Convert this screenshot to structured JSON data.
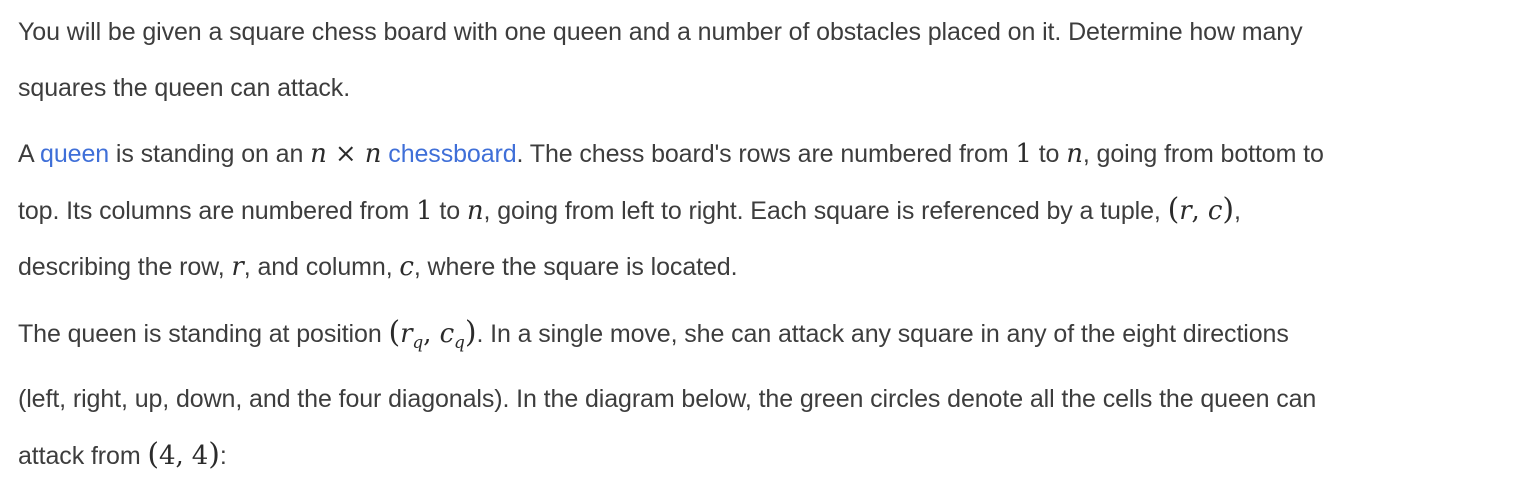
{
  "intro": {
    "line1": "You will be given a square chess board with one queen and a number of obstacles placed on it. Determine how many",
    "line2": "squares the queen can attack."
  },
  "para1": {
    "t1": "A ",
    "link_queen": "queen",
    "t2": " is standing on an ",
    "math_n1": "n",
    "math_times": " × ",
    "math_n2": "n",
    "t3": " ",
    "link_chessboard": "chessboard",
    "t4": ". The chess board's rows are numbered from ",
    "math_one1": "1",
    "t5": " to ",
    "math_n3": "n",
    "t6": ", going from bottom to",
    "t7": "top. Its columns are numbered from ",
    "math_one2": "1",
    "t8": " to ",
    "math_n4": "n",
    "t9": ", going from left to right. Each square is referenced by a tuple, ",
    "tuple_open": "(",
    "tuple_r": "r",
    "tuple_comma": ", ",
    "tuple_c": "c",
    "tuple_close": ")",
    "t10": ",",
    "t11": "describing the row, ",
    "math_r": "r",
    "t12": ", and column, ",
    "math_c": "c",
    "t13": ", where the square is located."
  },
  "para2": {
    "t1": "The queen is standing at position ",
    "pos_open": "(",
    "pos_r": "r",
    "pos_r_sub": "q",
    "pos_comma": ", ",
    "pos_c": "c",
    "pos_c_sub": "q",
    "pos_close": ")",
    "t2": ". In a single move, she can attack any square in any of the eight directions",
    "t3": "(left, right, up, down, and the four diagonals). In the diagram below, the green circles denote all the cells the queen can",
    "t4": "attack from ",
    "pt_open": "(",
    "pt_value": "4, 4",
    "pt_close": ")",
    "t5": ":"
  }
}
